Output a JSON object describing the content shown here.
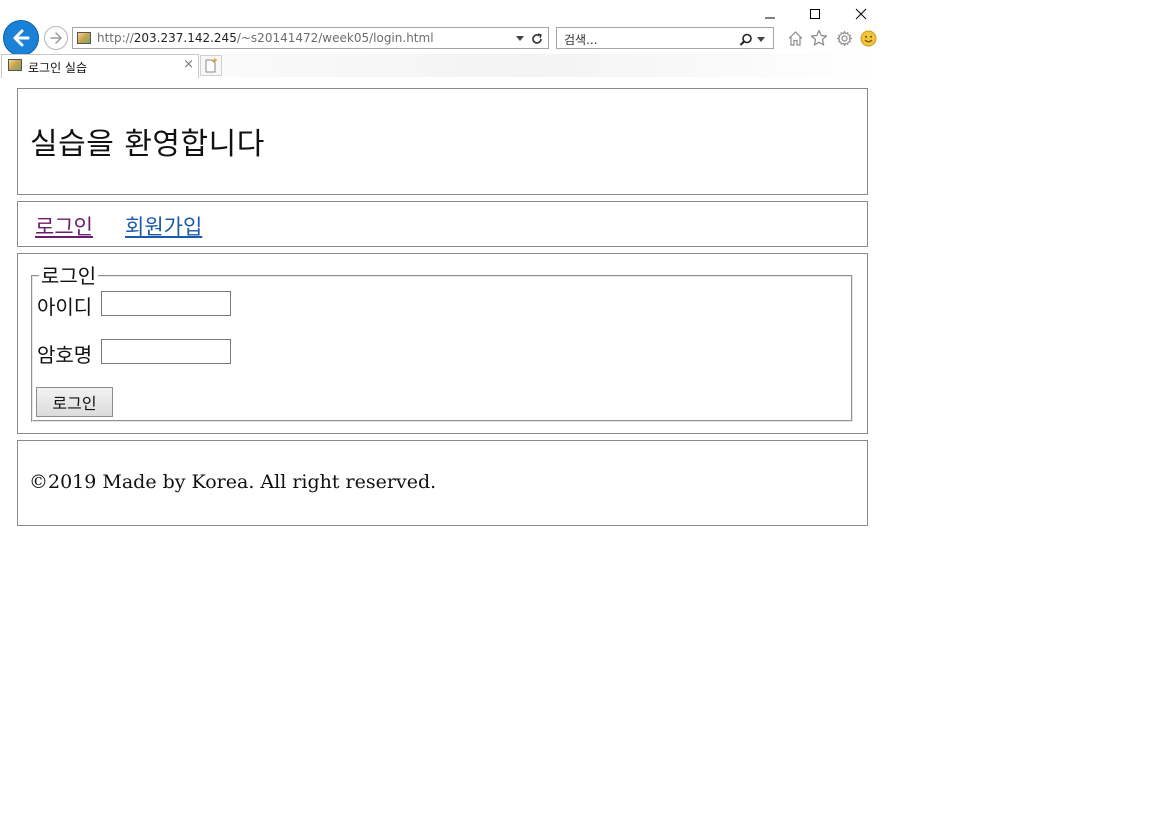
{
  "browser": {
    "address_url_prefix": "http://",
    "address_url_host": "203.237.142.245",
    "address_url_path": "/~s20141472/week05/login.html",
    "search_placeholder": "검색...",
    "tab_title": "로그인 실습",
    "tab_close": "×",
    "icons": {
      "back": "back-arrow-icon",
      "forward": "forward-arrow-icon",
      "refresh": "refresh-icon",
      "search": "search-icon",
      "home": "home-icon",
      "favorites": "star-icon",
      "settings": "gear-icon",
      "feedback": "smiley-icon",
      "minimize": "minimize-icon",
      "maximize": "maximize-icon",
      "close": "close-icon",
      "new_tab": "new-tab-icon"
    },
    "accent_color": "#1a82d6"
  },
  "page": {
    "header_title": "실습을 환영합니다",
    "nav": {
      "login": "로그인",
      "signup": "회원가입"
    },
    "form": {
      "legend": "로그인",
      "id_label": "아이디",
      "id_value": "",
      "password_label": "암호명",
      "password_value": "",
      "submit": "로그인"
    },
    "footer": "©2019 Made by Korea. All right reserved.",
    "colors": {
      "visited_link": "#6b1b6e",
      "link": "#1b5aa8"
    }
  }
}
